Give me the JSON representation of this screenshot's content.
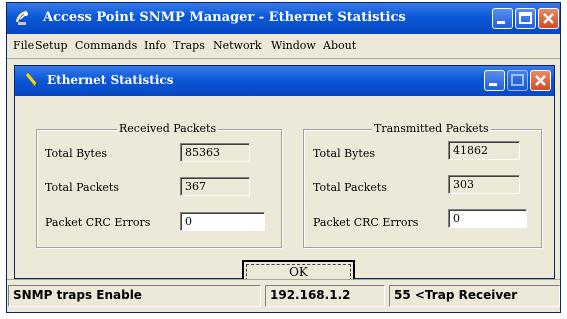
{
  "app": {
    "title": "Access Point SNMP Manager - Ethernet Statistics"
  },
  "menu": [
    "File",
    "Setup",
    "Commands",
    "Info",
    "Traps",
    "Network",
    "Window",
    "About"
  ],
  "child": {
    "title": "Ethernet Statistics",
    "received": {
      "legend": "Received Packets",
      "rows": [
        {
          "label": "Total Bytes",
          "value": "85363"
        },
        {
          "label": "Total Packets",
          "value": "367"
        },
        {
          "label": "Packet CRC Errors",
          "value": "0"
        }
      ]
    },
    "transmitted": {
      "legend": "Transmitted Packets",
      "rows": [
        {
          "label": "Total Bytes",
          "value": "41862"
        },
        {
          "label": "Total Packets",
          "value": "303"
        },
        {
          "label": "Packet CRC Errors",
          "value": "0"
        }
      ]
    },
    "ok_label": "OK"
  },
  "status": {
    "traps": "SNMP traps Enable",
    "ip": "192.168.1.2",
    "trap_receiver": "55 <Trap Receiver"
  },
  "colors": {
    "titlebar": "#0a58d8",
    "face": "#ece9d8",
    "close": "#d24a24"
  }
}
